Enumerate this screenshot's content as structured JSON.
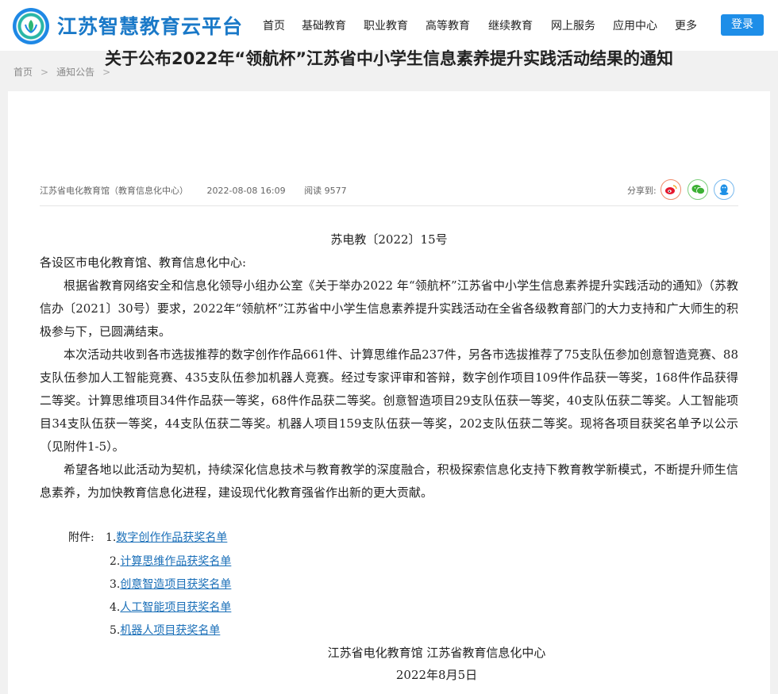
{
  "header": {
    "brand": "江苏智慧教育云平台",
    "nav": [
      "首页",
      "基础教育",
      "职业教育",
      "高等教育",
      "继续教育",
      "网上服务",
      "应用中心",
      "更多"
    ],
    "login": "登录"
  },
  "breadcrumb": {
    "home": "首页",
    "section": "通知公告"
  },
  "article": {
    "title": "关于公布2022年“领航杯”江苏省中小学生信息素养提升实践活动结果的通知",
    "source": "江苏省电化教育馆（教育信息化中心）",
    "date": "2022-08-08 16:09",
    "views": "阅读 9577",
    "share_label": "分享到:",
    "doc_number": "苏电教〔2022〕15号",
    "salutation": "各设区市电化教育馆、教育信息化中心:",
    "paragraphs": [
      "根据省教育网络安全和信息化领导小组办公室《关于举办2022 年“领航杯”江苏省中小学生信息素养提升实践活动的通知》（苏教信办〔2021〕30号）要求，2022年“领航杯”江苏省中小学生信息素养提升实践活动在全省各级教育部门的大力支持和广大师生的积极参与下，已圆满结束。",
      "本次活动共收到各市选拔推荐的数字创作作品661件、计算思维作品237件，另各市选拔推荐了75支队伍参加创意智造竞赛、88支队伍参加人工智能竞赛、435支队伍参加机器人竞赛。经过专家评审和答辩，数字创作项目109件作品获一等奖，168件作品获得二等奖。计算思维项目34件作品获一等奖，68件作品获二等奖。创意智造项目29支队伍获一等奖，40支队伍获二等奖。人工智能项目34支队伍获一等奖，44支队伍获二等奖。机器人项目159支队伍获一等奖，202支队伍获二等奖。现将各项目获奖名单予以公示（见附件1-5）。",
      "希望各地以此活动为契机，持续深化信息技术与教育教学的深度融合，积极探索信息化支持下教育教学新模式，不断提升师生信息素养，为加快教育信息化进程，建设现代化教育强省作出新的更大贡献。"
    ],
    "attachments_label": "附件:",
    "attachments": [
      {
        "num": "1.",
        "label": "数字创作作品获奖名单"
      },
      {
        "num": "2.",
        "label": "计算思维作品获奖名单"
      },
      {
        "num": "3.",
        "label": "创意智造项目获奖名单"
      },
      {
        "num": "4.",
        "label": "人工智能项目获奖名单"
      },
      {
        "num": "5.",
        "label": "机器人项目获奖名单"
      }
    ],
    "signature": "江苏省电化教育馆  江苏省教育信息化中心",
    "sign_date": "2022年8月5日"
  },
  "icons": [
    "weibo-icon",
    "wechat-icon",
    "qq-icon"
  ],
  "colors": {
    "brand": "#1a79c8",
    "accent": "#1e8ee8",
    "link": "#1a6fb8"
  }
}
